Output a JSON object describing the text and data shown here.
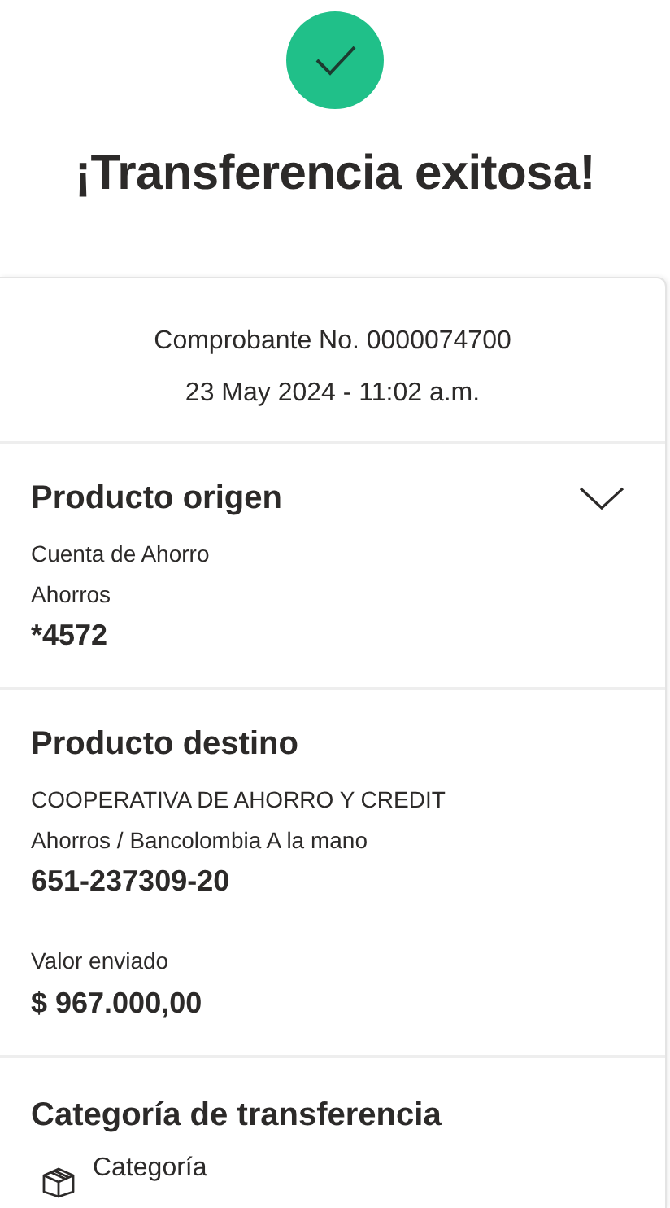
{
  "header": {
    "title": "¡Transferencia exitosa!"
  },
  "receipt": {
    "number": "Comprobante No. 0000074700",
    "datetime": "23 May 2024 - 11:02 a.m."
  },
  "sections": [
    {
      "kind": "product",
      "title": "Producto origen",
      "collapsible": true,
      "lines": [
        "Cuenta de Ahorro",
        "Ahorros"
      ],
      "account": "*4572"
    },
    {
      "kind": "product",
      "title": "Producto destino",
      "collapsible": false,
      "lines": [
        "COOPERATIVA DE AHORRO Y CREDIT",
        "Ahorros / Bancolombia A la mano"
      ],
      "account": "651-237309-20",
      "amount_label": "Valor enviado",
      "amount": "$ 967.000,00"
    },
    {
      "kind": "category",
      "title": "Categoría de transferencia",
      "items": [
        {
          "label": "Categoría"
        }
      ]
    }
  ]
}
